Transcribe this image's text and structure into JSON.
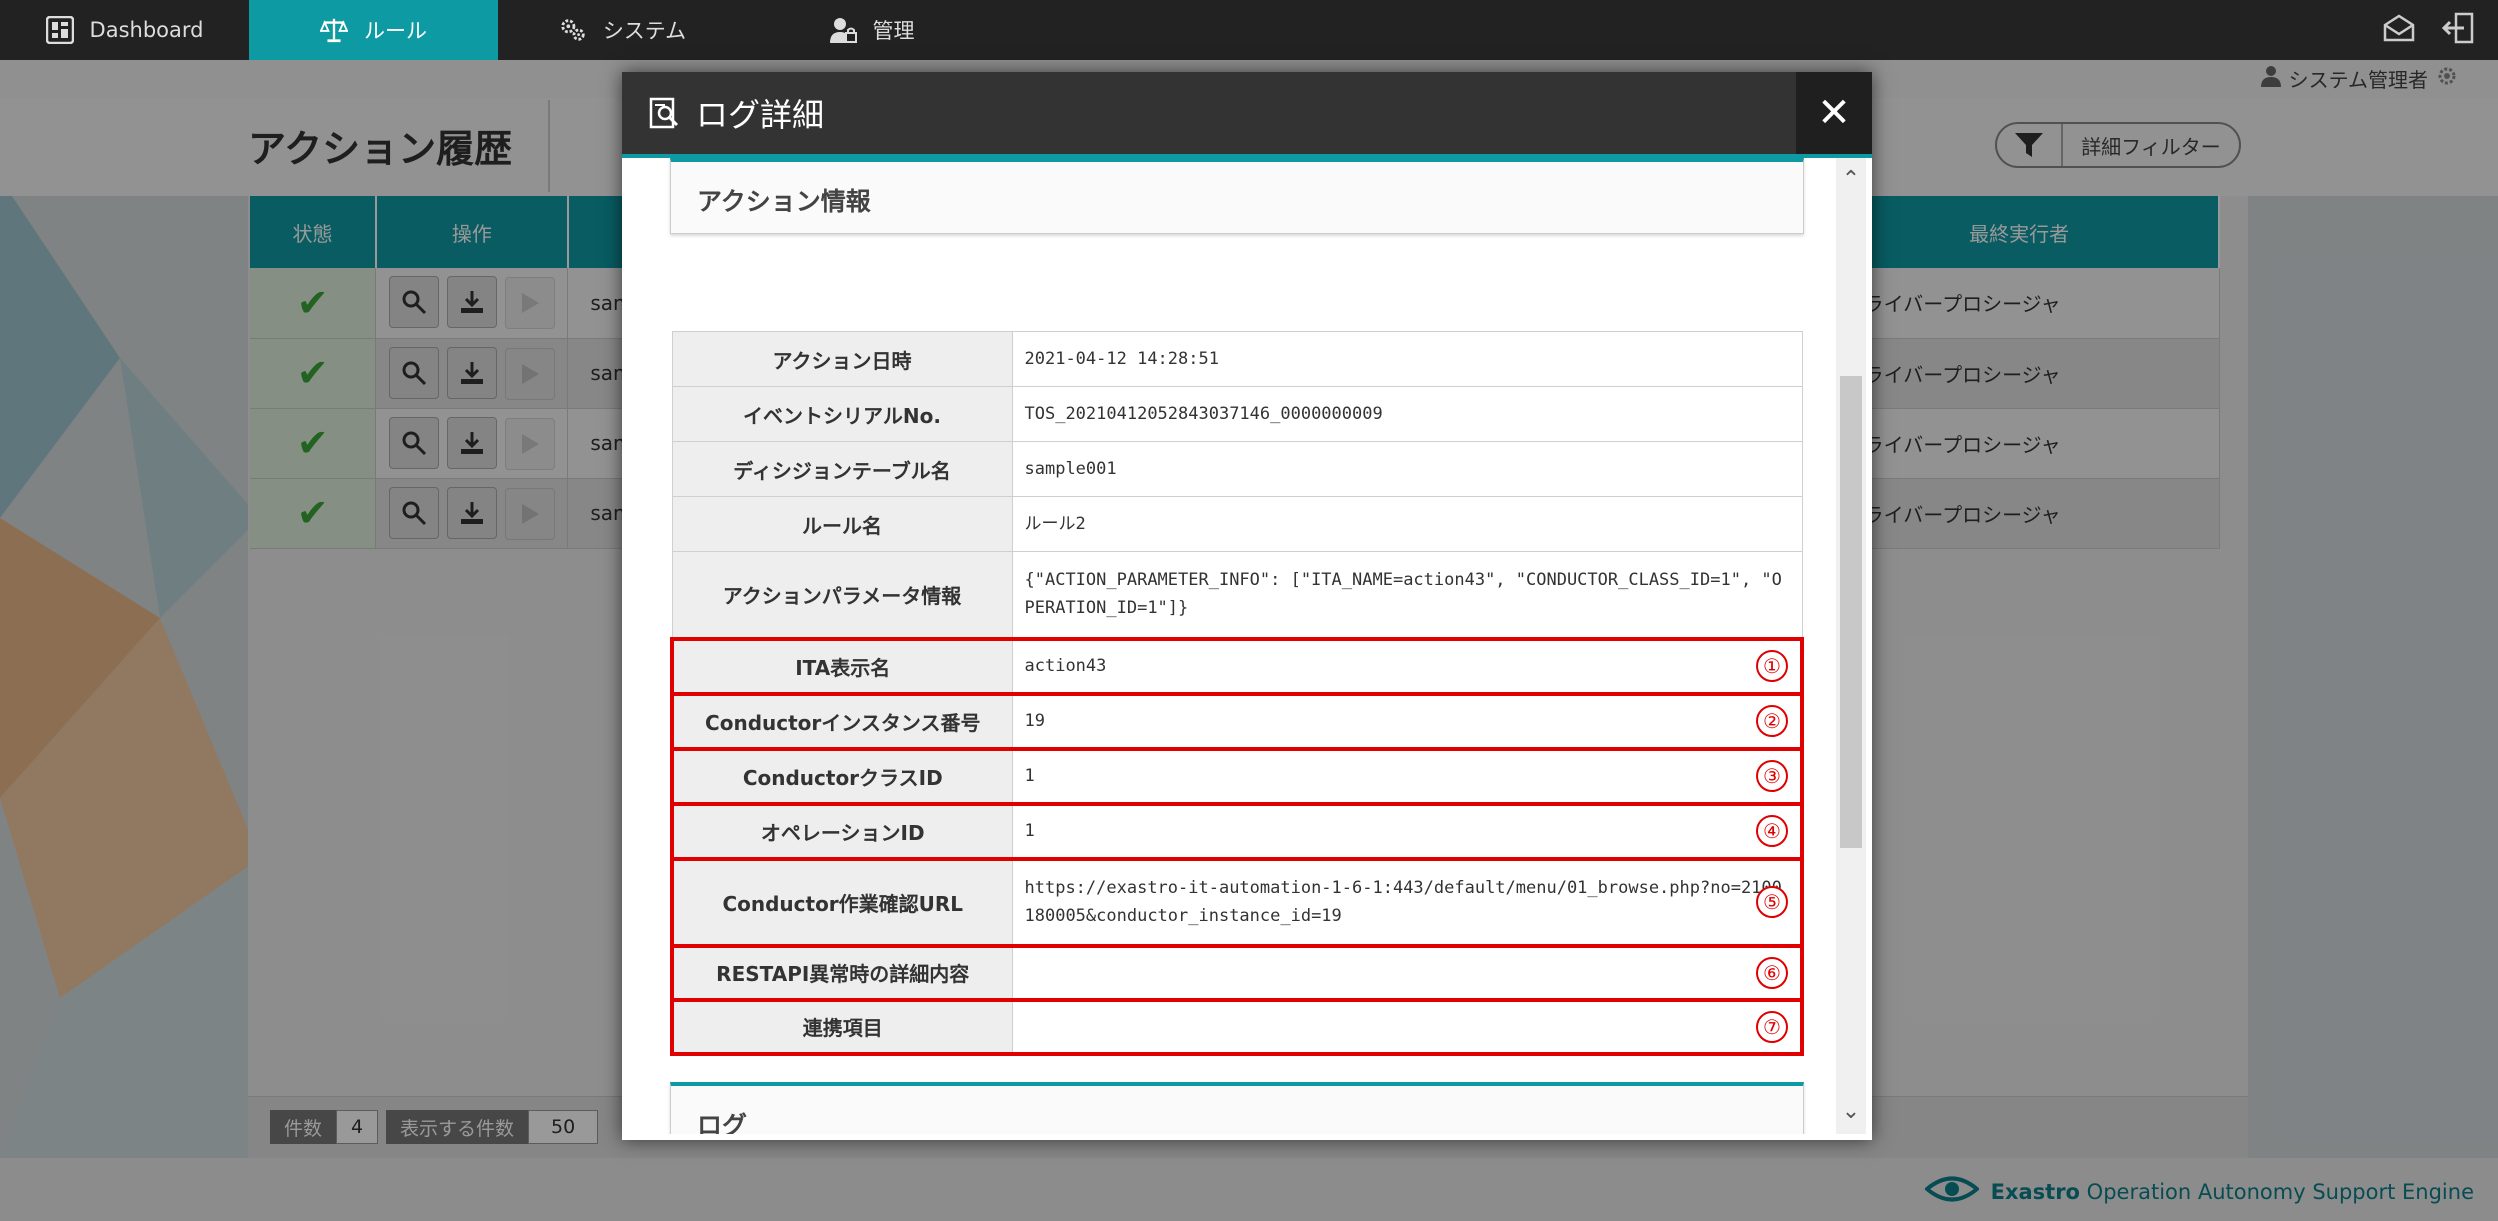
{
  "nav": {
    "items": [
      {
        "label": "Dashboard",
        "icon": "dashboard-icon",
        "active": false
      },
      {
        "label": "ルール",
        "icon": "scale-icon",
        "active": true
      },
      {
        "label": "システム",
        "icon": "gears-icon",
        "active": false
      },
      {
        "label": "管理",
        "icon": "user-admin-icon",
        "active": false
      }
    ]
  },
  "user": {
    "name": "システム管理者"
  },
  "page": {
    "title": "アクション履歴",
    "filter_button": "詳細フィルター",
    "table": {
      "headers": {
        "status": "状態",
        "operations": "操作",
        "last_executor": "最終実行者"
      },
      "rows": [
        {
          "name_prefix": "sam",
          "executor": "ドライバープロシージャ"
        },
        {
          "name_prefix": "sam",
          "executor": "ドライバープロシージャ"
        },
        {
          "name_prefix": "sam",
          "executor": "ドライバープロシージャ"
        },
        {
          "name_prefix": "sam",
          "executor": "ドライバープロシージャ"
        }
      ]
    },
    "footer": {
      "count_label": "件数",
      "count_value": "4",
      "per_page_label": "表示する件数",
      "per_page_value": "50"
    },
    "brand": {
      "strong": "Exastro",
      "rest": "Operation Autonomy Support Engine"
    }
  },
  "modal": {
    "title": "ログ詳細",
    "close_symbol": "✕",
    "section_action": "アクション情報",
    "section_log": "ログ",
    "rows": [
      {
        "label": "アクション日時",
        "value": "2021-04-12 14:28:51"
      },
      {
        "label": "イベントシリアルNo.",
        "value": "TOS_20210412052843037146_0000000009"
      },
      {
        "label": "ディシジョンテーブル名",
        "value": "sample001"
      },
      {
        "label": "ルール名",
        "value": "ルール2"
      },
      {
        "label": "アクションパラメータ情報",
        "value": "{\"ACTION_PARAMETER_INFO\": [\"ITA_NAME=action43\", \"CONDUCTOR_CLASS_ID=1\", \"OPERATION_ID=1\"]}"
      },
      {
        "label": "ITA表示名",
        "value": "action43",
        "marker": "①"
      },
      {
        "label": "Conductorインスタンス番号",
        "value": "19",
        "marker": "②"
      },
      {
        "label": "ConductorクラスID",
        "value": "1",
        "marker": "③"
      },
      {
        "label": "オペレーションID",
        "value": "1",
        "marker": "④"
      },
      {
        "label": "Conductor作業確認URL",
        "value": "https://exastro-it-automation-1-6-1:443/default/menu/01_browse.php?no=2100180005&conductor_instance_id=19",
        "marker": "⑤"
      },
      {
        "label": "RESTAPI異常時の詳細内容",
        "value": "",
        "marker": "⑥"
      },
      {
        "label": "連携項目",
        "value": "",
        "marker": "⑦"
      }
    ]
  },
  "colors": {
    "accent": "#0e9aa3",
    "highlight": "#e00000",
    "success": "#3aa53a"
  }
}
